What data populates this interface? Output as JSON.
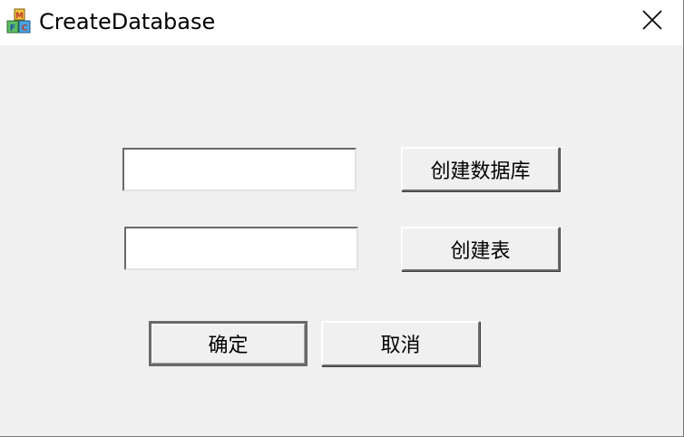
{
  "window": {
    "title": "CreateDatabase",
    "app_icon": "mfc-blocks-icon",
    "close_icon": "close-icon"
  },
  "form": {
    "database_name_value": "",
    "table_name_value": "",
    "create_database_label": "创建数据库",
    "create_table_label": "创建表",
    "ok_label": "确定",
    "cancel_label": "取消"
  }
}
